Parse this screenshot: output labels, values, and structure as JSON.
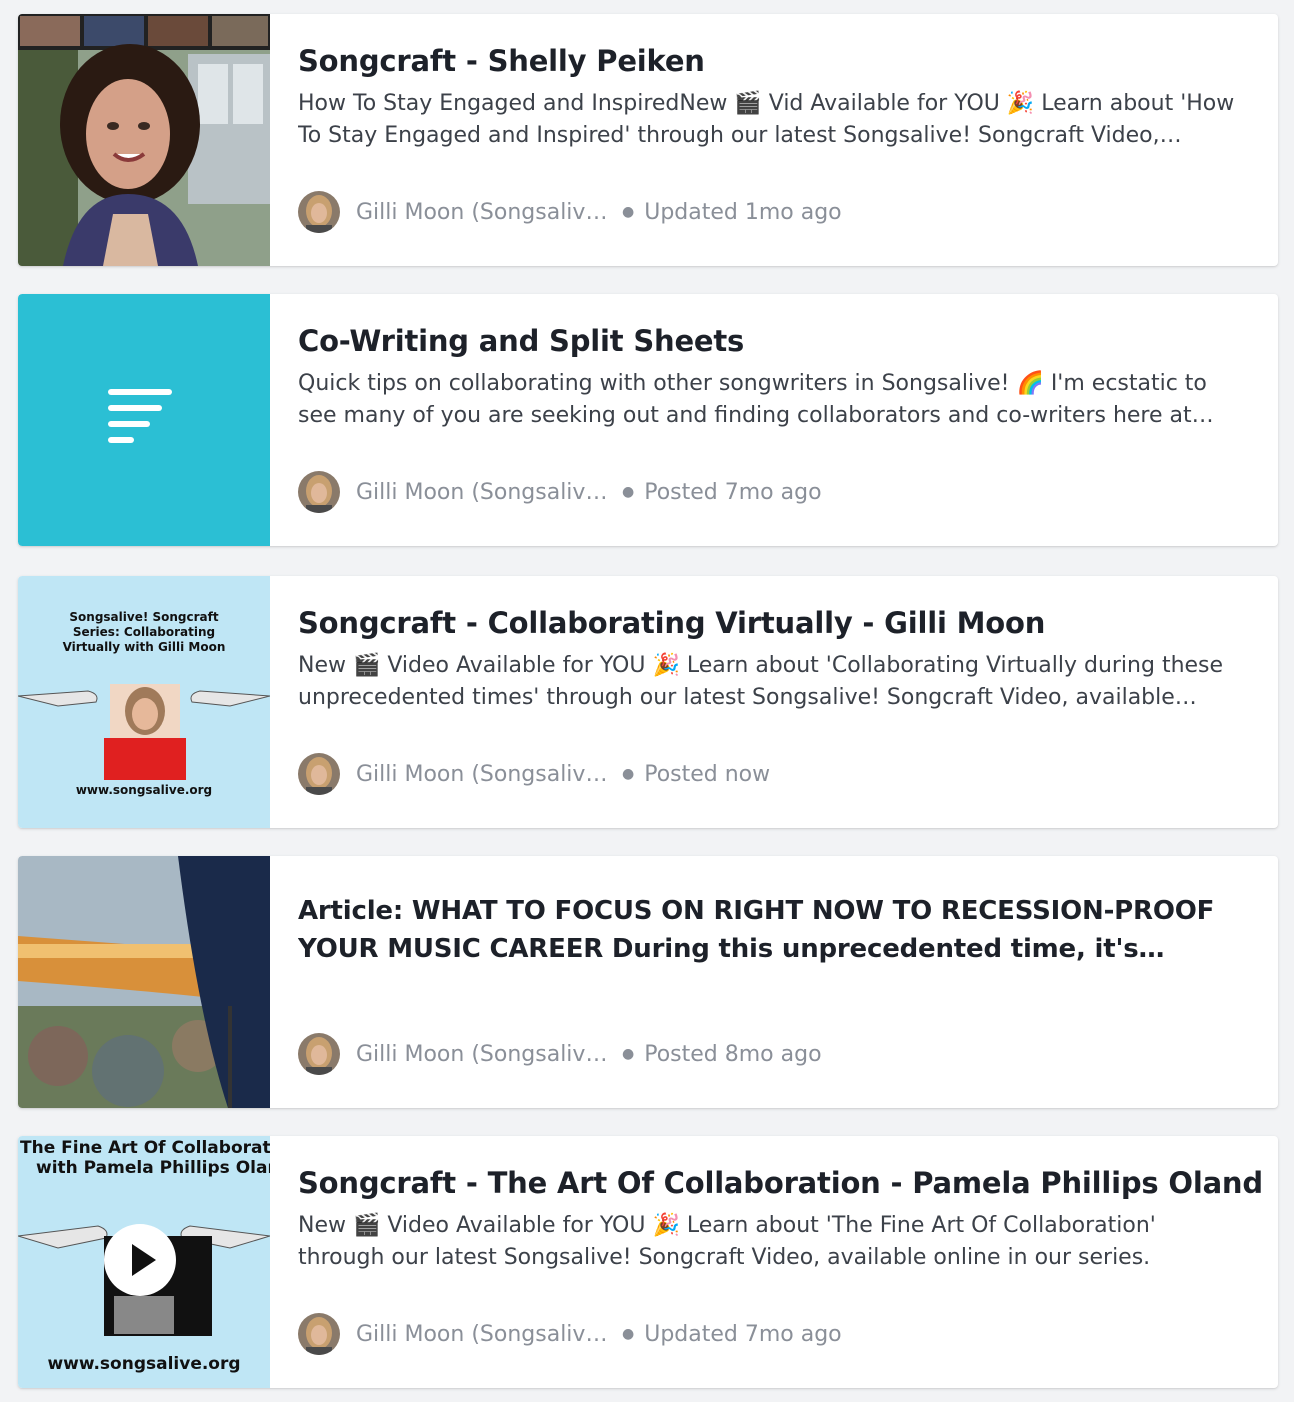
{
  "posts": [
    {
      "title": "Songcraft - Shelly Peiken",
      "description": "How To Stay Engaged and InspiredNew 🎬 Vid Available for YOU 🎉  Learn about 'How To Stay Engaged and Inspired' through our latest Songsalive! Songcraft Video, available online in our Songcraft series.",
      "author": "Gilli Moon (Songsalive!)",
      "time": "Updated 1mo ago",
      "thumbnail": "video-call-thumbnail"
    },
    {
      "title": "Co-Writing and Split Sheets",
      "description": "Quick tips on collaborating with other songwriters in Songsalive! 🌈  I'm ecstatic to see many of you are seeking out and finding collaborators and co-writers here at Songsalive!",
      "author": "Gilli Moon (Songsalive!)",
      "time": "Posted 7mo ago",
      "thumbnail": "text-lines-icon",
      "thumbnail_color": "#2bbfd4"
    },
    {
      "title": "Songcraft - Collaborating Virtually - Gilli Moon",
      "description": "New 🎬 Video Available for YOU 🎉  Learn about 'Collaborating Virtually during these unprecedented times' through our latest Songsalive! Songcraft Video, available online now.",
      "author": "Gilli Moon (Songsalive!)",
      "time": "Posted now",
      "thumbnail": "songcraft-series-graphic",
      "thumb_heading": "Songsalive! Songcraft Series: Collaborating Virtually with Gilli Moon",
      "thumb_url": "www.songsalive.org"
    },
    {
      "title": "Article: WHAT TO FOCUS ON RIGHT NOW TO RECESSION-PROOF YOUR MUSIC CAREER During this unprecedented time, it's important to focus on what matters.",
      "description": "",
      "author": "Gilli Moon (Songsalive!)",
      "time": "Posted 8mo ago",
      "thumbnail": "guitar-photo"
    },
    {
      "title": "Songcraft - The Art Of Collaboration - Pamela Phillips Oland",
      "description": " New 🎬 Video Available for YOU 🎉  Learn about 'The Fine Art Of Collaboration' through our latest Songsalive! Songcraft Video, available online in our series.",
      "author": "Gilli Moon (Songsalive!)",
      "time": "Updated 7mo ago",
      "thumbnail": "collaboration-video-graphic",
      "thumb_heading_1": "The Fine Art Of Collaboration",
      "thumb_heading_2": "with Pamela Phillips Oland",
      "thumb_url": "www.songsalive.org"
    }
  ]
}
